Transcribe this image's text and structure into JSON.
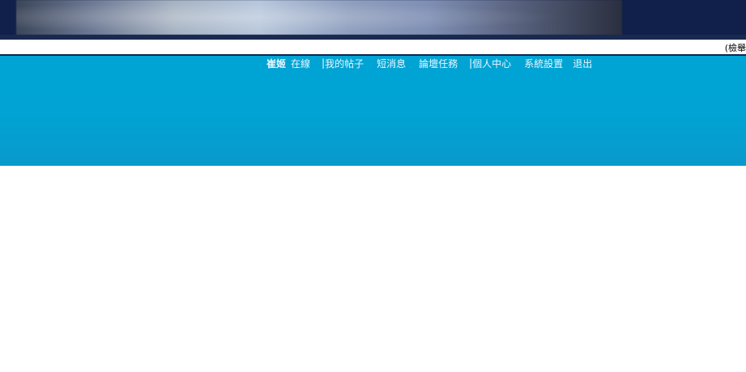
{
  "notice": {
    "text": "(檢舉"
  },
  "nav": {
    "username": "崔姬",
    "status": "在線",
    "separator": "|",
    "my_posts": "我的帖子",
    "messages": "短消息",
    "tasks": "論壇任務",
    "profile": "個人中心",
    "settings": "系統設置",
    "logout": "退出"
  },
  "colors": {
    "header_bg": "#00a4d4",
    "banner_bg": "#10204a"
  }
}
